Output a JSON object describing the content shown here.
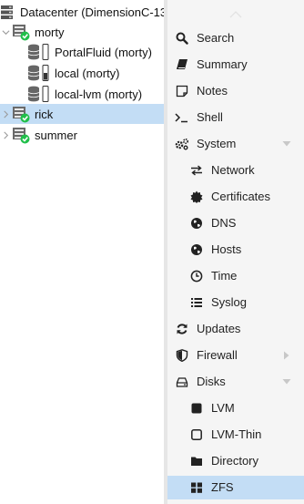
{
  "tree": {
    "datacenter": {
      "label": "Datacenter (DimensionC-13",
      "icon": "server-rack-icon"
    },
    "nodes": [
      {
        "label": "morty",
        "expanded": true,
        "status": "online",
        "storages": [
          {
            "label": "PortalFluid (morty)",
            "icon": "database-icon"
          },
          {
            "label": "local (morty)",
            "icon": "database-icon"
          },
          {
            "label": "local-lvm (morty)",
            "icon": "database-icon"
          }
        ]
      },
      {
        "label": "rick",
        "expanded": false,
        "status": "online",
        "selected": true
      },
      {
        "label": "summer",
        "expanded": false,
        "status": "online"
      }
    ]
  },
  "nav": {
    "items": [
      {
        "label": "Search",
        "icon": "search-icon"
      },
      {
        "label": "Summary",
        "icon": "book-icon"
      },
      {
        "label": "Notes",
        "icon": "sticky-note-icon"
      },
      {
        "label": "Shell",
        "icon": "terminal-icon"
      },
      {
        "label": "System",
        "icon": "cogs-icon",
        "caret": "down"
      },
      {
        "label": "Network",
        "icon": "exchange-icon",
        "indent": true
      },
      {
        "label": "Certificates",
        "icon": "certificate-icon",
        "indent": true
      },
      {
        "label": "DNS",
        "icon": "globe-icon",
        "indent": true
      },
      {
        "label": "Hosts",
        "icon": "globe-icon",
        "indent": true
      },
      {
        "label": "Time",
        "icon": "clock-icon",
        "indent": true
      },
      {
        "label": "Syslog",
        "icon": "list-icon",
        "indent": true
      },
      {
        "label": "Updates",
        "icon": "refresh-icon"
      },
      {
        "label": "Firewall",
        "icon": "shield-icon",
        "caret": "right"
      },
      {
        "label": "Disks",
        "icon": "hdd-icon",
        "caret": "down"
      },
      {
        "label": "LVM",
        "icon": "square-icon",
        "indent": true
      },
      {
        "label": "LVM-Thin",
        "icon": "square-outline-icon",
        "indent": true
      },
      {
        "label": "Directory",
        "icon": "folder-icon",
        "indent": true
      },
      {
        "label": "ZFS",
        "icon": "th-large-icon",
        "indent": true,
        "active": true
      }
    ]
  },
  "colors": {
    "selection": "#c3ddf5",
    "online_badge": "#21bf4b",
    "node_icon": "#6a6a6a"
  }
}
